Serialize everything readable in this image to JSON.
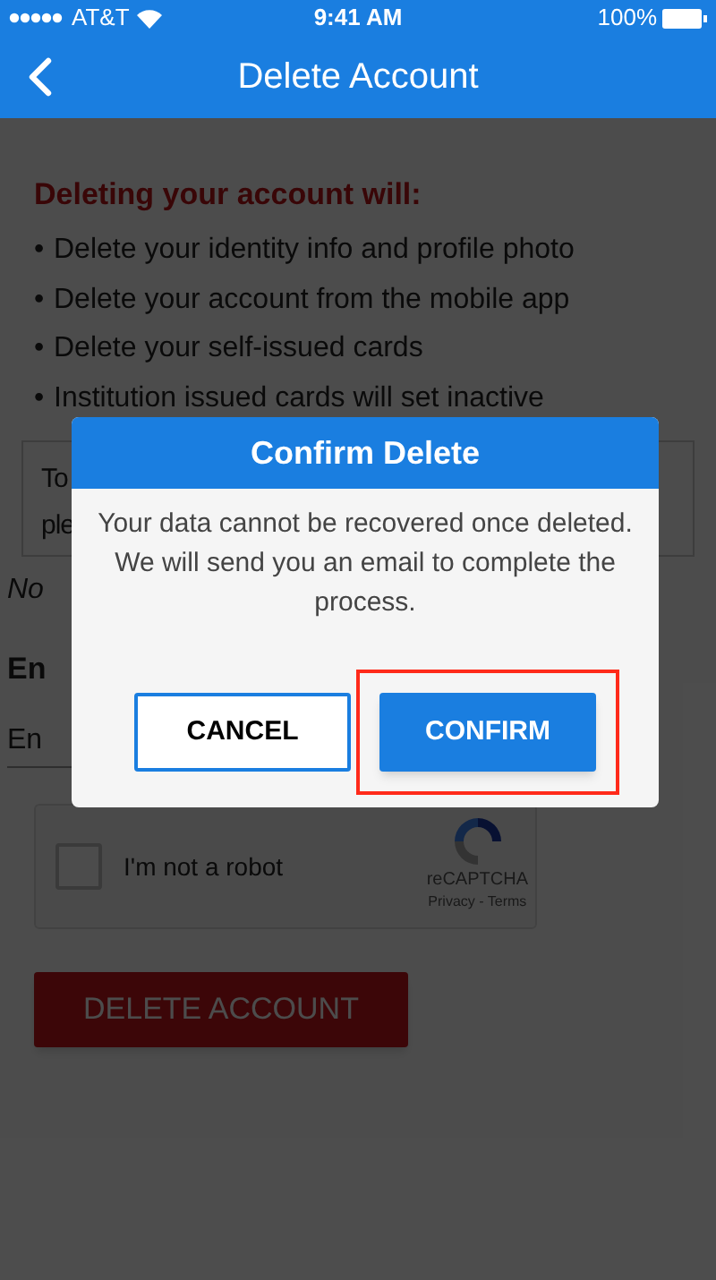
{
  "status_bar": {
    "carrier": "AT&T",
    "time": "9:41 AM",
    "battery": "100%"
  },
  "nav_bar": {
    "title": "Delete Account"
  },
  "content": {
    "heading": "Deleting your account will:",
    "bullets": [
      {
        "marker": "•",
        "text": "Delete your identity info and profile photo"
      },
      {
        "marker": "•",
        "text": "Delete your account from the mobile app"
      },
      {
        "marker": "•",
        "text": "Delete your self-issued cards"
      },
      {
        "marker": "•",
        "text": "Institution issued cards will set inactive"
      }
    ],
    "notice_lines": [
      "To",
      "ple"
    ],
    "note": "No",
    "email_label": "En",
    "email_placeholder": "En",
    "captcha": {
      "label": "I'm not a robot",
      "checked": false,
      "brand": "reCAPTCHA",
      "links": "Privacy - Terms"
    },
    "delete_button": "DELETE ACCOUNT"
  },
  "dialog": {
    "title": "Confirm Delete",
    "message": "Your data cannot be recovered once deleted. We will send you an email to complete the process.",
    "buttons": [
      {
        "label": "CANCEL",
        "kind": "outline",
        "highlighted": false
      },
      {
        "label": "CONFIRM",
        "kind": "filled",
        "highlighted": true
      }
    ]
  }
}
